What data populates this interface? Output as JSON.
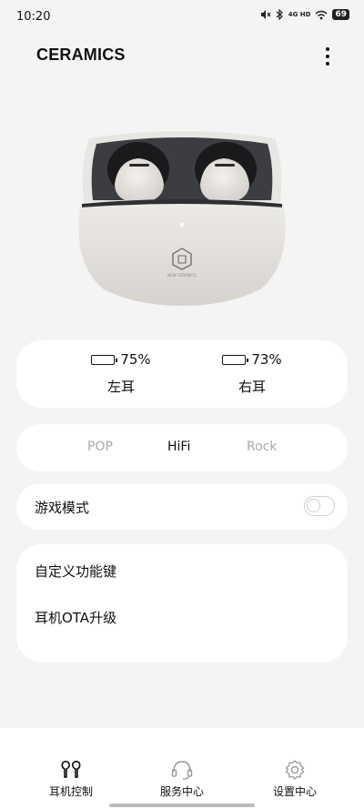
{
  "status_bar": {
    "time": "10:20",
    "network": "4G HD",
    "battery": "69"
  },
  "header": {
    "title": "CERAMICS"
  },
  "device": {
    "case_logo_text": "NEW CERAMICS"
  },
  "battery": {
    "left": {
      "percent": "75%",
      "level": 0.75,
      "label": "左耳"
    },
    "right": {
      "percent": "73%",
      "level": 0.73,
      "label": "右耳"
    }
  },
  "eq": {
    "options": [
      "POP",
      "HiFi",
      "Rock"
    ],
    "selected": "HiFi"
  },
  "game_mode": {
    "label": "游戏模式",
    "enabled": false
  },
  "menu": {
    "items": [
      "自定义功能键",
      "耳机OTA升级"
    ]
  },
  "bottom_nav": {
    "items": [
      {
        "label": "耳机控制",
        "icon": "earbuds-icon",
        "active": true
      },
      {
        "label": "服务中心",
        "icon": "headset-icon",
        "active": false
      },
      {
        "label": "设置中心",
        "icon": "gear-icon",
        "active": false
      }
    ]
  },
  "colors": {
    "background": "#f4f4f4",
    "card": "#ffffff",
    "text": "#111111",
    "inactive_text": "#aaaaaa"
  }
}
